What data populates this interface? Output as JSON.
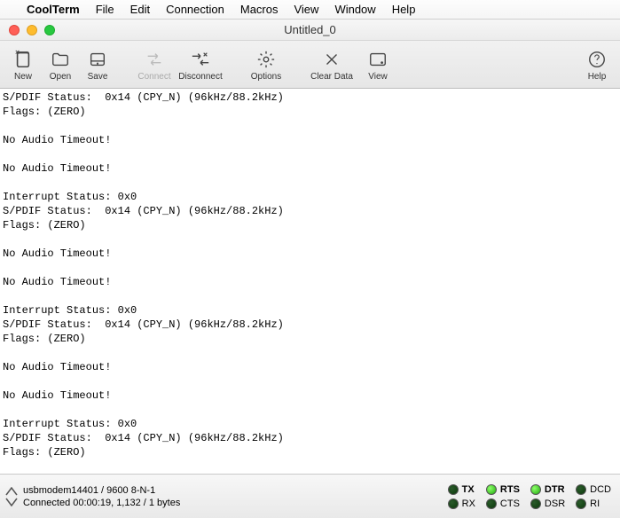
{
  "menubar": {
    "app": "CoolTerm",
    "items": [
      "File",
      "Edit",
      "Connection",
      "Macros",
      "View",
      "Window",
      "Help"
    ]
  },
  "window": {
    "title": "Untitled_0"
  },
  "toolbar": {
    "new": "New",
    "open": "Open",
    "save": "Save",
    "connect": "Connect",
    "disconnect": "Disconnect",
    "options": "Options",
    "cleardata": "Clear Data",
    "view": "View",
    "help": "Help"
  },
  "terminal_lines": [
    "S/PDIF Status:  0x14 (CPY_N) (96kHz/88.2kHz)",
    "Flags: (ZERO)",
    "",
    "No Audio Timeout!",
    "",
    "No Audio Timeout!",
    "",
    "Interrupt Status: 0x0",
    "S/PDIF Status:  0x14 (CPY_N) (96kHz/88.2kHz)",
    "Flags: (ZERO)",
    "",
    "No Audio Timeout!",
    "",
    "No Audio Timeout!",
    "",
    "Interrupt Status: 0x0",
    "S/PDIF Status:  0x14 (CPY_N) (96kHz/88.2kHz)",
    "Flags: (ZERO)",
    "",
    "No Audio Timeout!",
    "",
    "No Audio Timeout!",
    "",
    "Interrupt Status: 0x0",
    "S/PDIF Status:  0x14 (CPY_N) (96kHz/88.2kHz)",
    "Flags: (ZERO)"
  ],
  "status": {
    "port": "usbmodem14401 / 9600 8-N-1",
    "conn": "Connected 00:00:19, 1,132 / 1 bytes",
    "signals": {
      "TX": {
        "label": "TX",
        "on": false,
        "bold": true
      },
      "RTS": {
        "label": "RTS",
        "on": true,
        "bold": true
      },
      "DTR": {
        "label": "DTR",
        "on": true,
        "bold": true
      },
      "DCD": {
        "label": "DCD",
        "on": false,
        "bold": false
      },
      "RX": {
        "label": "RX",
        "on": false,
        "bold": false
      },
      "CTS": {
        "label": "CTS",
        "on": false,
        "bold": false
      },
      "DSR": {
        "label": "DSR",
        "on": false,
        "bold": false
      },
      "RI": {
        "label": "RI",
        "on": false,
        "bold": false
      }
    }
  }
}
